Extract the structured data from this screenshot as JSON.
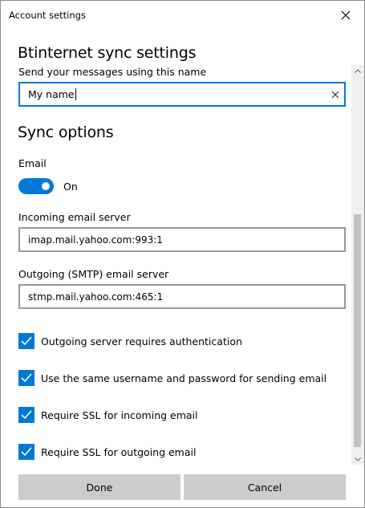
{
  "window": {
    "title": "Account settings",
    "close_icon": "close-icon"
  },
  "section": {
    "heading": "Btinternet sync settings",
    "name_label": "Send your messages using this name",
    "name_value": "My name"
  },
  "sync": {
    "heading": "Sync options",
    "email_label": "Email",
    "email_toggle_state": "On",
    "email_toggle_on": true,
    "incoming_label": "Incoming email server",
    "incoming_value": "imap.mail.yahoo.com:993:1",
    "outgoing_label": "Outgoing (SMTP) email server",
    "outgoing_value": "stmp.mail.yahoo.com:465:1"
  },
  "checkboxes": [
    {
      "label": "Outgoing server requires authentication",
      "checked": true
    },
    {
      "label": "Use the same username and password for sending email",
      "checked": true
    },
    {
      "label": "Require SSL for incoming email",
      "checked": true
    },
    {
      "label": "Require SSL for outgoing email",
      "checked": true
    }
  ],
  "buttons": {
    "done": "Done",
    "cancel": "Cancel"
  },
  "colors": {
    "accent": "#0078d7",
    "button_bg": "#cccccc",
    "field_border": "#999999"
  }
}
